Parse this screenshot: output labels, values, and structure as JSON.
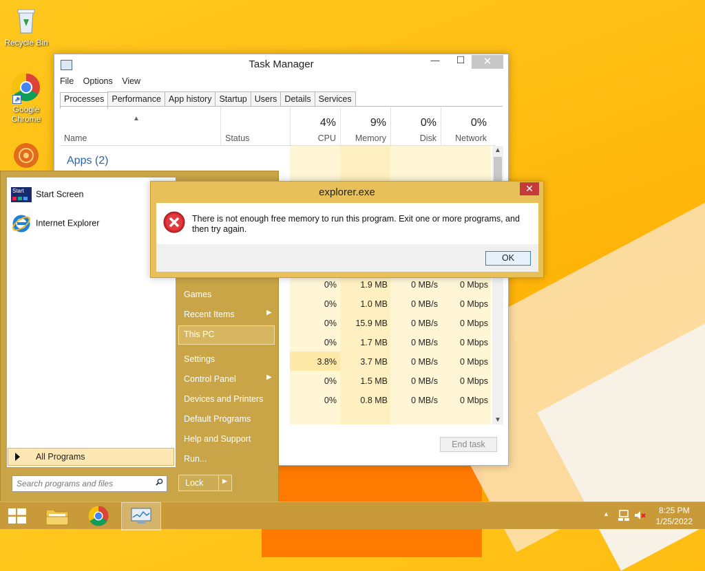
{
  "desktop": {
    "icons": [
      {
        "label": "Recycle Bin"
      },
      {
        "label": "Google Chrome"
      }
    ]
  },
  "task_manager": {
    "title": "Task Manager",
    "menu": [
      "File",
      "Options",
      "View"
    ],
    "tabs": [
      "Processes",
      "Performance",
      "App history",
      "Startup",
      "Users",
      "Details",
      "Services"
    ],
    "columns": {
      "name": "Name",
      "status": "Status",
      "cpu": {
        "pct": "4%",
        "label": "CPU"
      },
      "memory": {
        "pct": "9%",
        "label": "Memory"
      },
      "disk": {
        "pct": "0%",
        "label": "Disk"
      },
      "network": {
        "pct": "0%",
        "label": "Network"
      }
    },
    "group_apps": "Apps (2)",
    "rows": [
      {
        "cpu": "0%",
        "mem": "1.9 MB",
        "disk": "0 MB/s",
        "net": "0 Mbps"
      },
      {
        "cpu": "0%",
        "mem": "1.0 MB",
        "disk": "0 MB/s",
        "net": "0 Mbps"
      },
      {
        "cpu": "0%",
        "mem": "15.9 MB",
        "disk": "0 MB/s",
        "net": "0 Mbps"
      },
      {
        "cpu": "0%",
        "mem": "1.7 MB",
        "disk": "0 MB/s",
        "net": "0 Mbps"
      },
      {
        "cpu": "3.8%",
        "mem": "3.7 MB",
        "disk": "0 MB/s",
        "net": "0 Mbps"
      },
      {
        "cpu": "0%",
        "mem": "1.5 MB",
        "disk": "0 MB/s",
        "net": "0 Mbps"
      },
      {
        "cpu": "0%",
        "mem": "0.8 MB",
        "disk": "0 MB/s",
        "net": "0 Mbps"
      }
    ],
    "end_task": "End task"
  },
  "start_menu": {
    "left_items": [
      "Start Screen",
      "Internet Explorer"
    ],
    "all_programs": "All Programs",
    "search_placeholder": "Search programs and files",
    "right_items": [
      "Games",
      "Recent Items",
      "This PC",
      "Settings",
      "Control Panel",
      "Devices and Printers",
      "Default Programs",
      "Help and Support",
      "Run..."
    ],
    "lock": "Lock"
  },
  "dialog": {
    "title": "explorer.exe",
    "message": "There is not enough free memory to run this program. Exit one or more programs, and then try again.",
    "ok": "OK"
  },
  "taskbar": {
    "time": "8:25 PM",
    "date": "1/25/2022"
  }
}
